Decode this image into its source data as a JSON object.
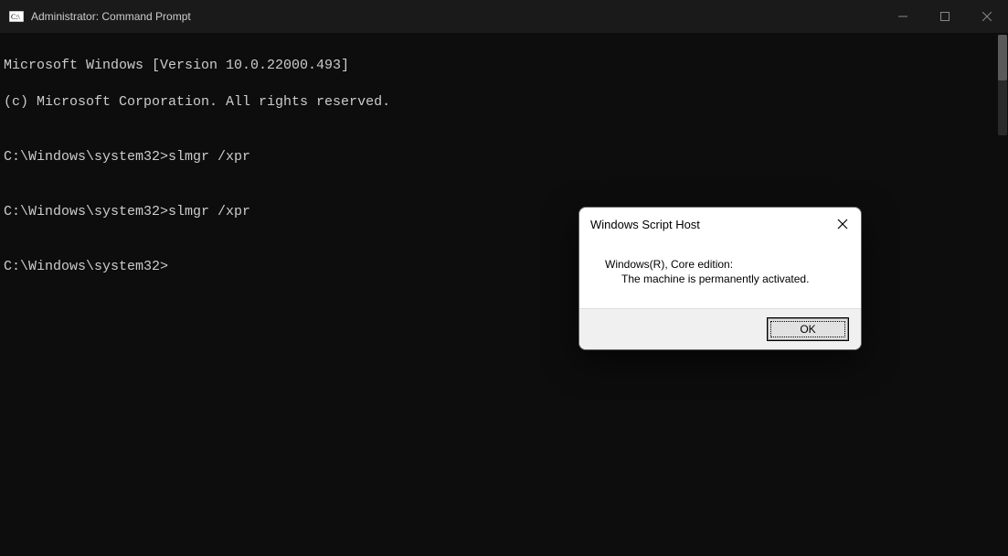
{
  "window": {
    "title": "Administrator: Command Prompt"
  },
  "terminal": {
    "lines": [
      "Microsoft Windows [Version 10.0.22000.493]",
      "(c) Microsoft Corporation. All rights reserved.",
      "",
      "C:\\Windows\\system32>slmgr /xpr",
      "",
      "C:\\Windows\\system32>slmgr /xpr",
      "",
      "C:\\Windows\\system32>"
    ]
  },
  "dialog": {
    "title": "Windows Script Host",
    "message_line1": "Windows(R), Core edition:",
    "message_line2": "The machine is permanently activated.",
    "ok_label": "OK"
  }
}
